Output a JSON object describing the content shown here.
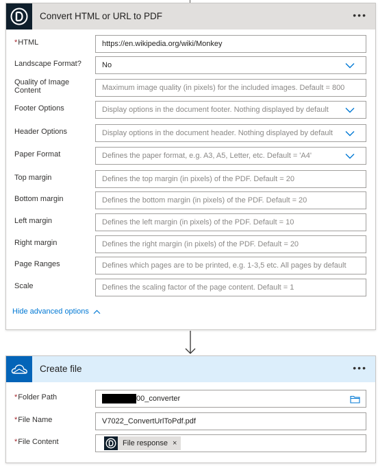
{
  "action1": {
    "title": "Convert HTML or URL to PDF",
    "more_label": "•••",
    "icon": "pdf-logo-icon",
    "fields": [
      {
        "label": "HTML",
        "required": true,
        "value": "https://en.wikipedia.org/wiki/Monkey",
        "placeholder": ""
      },
      {
        "label": "Landscape Format?",
        "required": false,
        "value": "No",
        "placeholder": "",
        "dropdown": true
      },
      {
        "label": "Quality of Image Content",
        "required": false,
        "value": "",
        "placeholder": "Maximum image quality (in pixels) for the included images. Default = 800"
      },
      {
        "label": "Footer Options",
        "required": false,
        "value": "",
        "placeholder": "Display options in the document footer. Nothing displayed by default",
        "dropdown": true
      },
      {
        "label": "Header Options",
        "required": false,
        "value": "",
        "placeholder": "Display options in the document header. Nothing displayed by default",
        "dropdown": true
      },
      {
        "label": "Paper Format",
        "required": false,
        "value": "",
        "placeholder": "Defines the paper format, e.g. A3, A5, Letter, etc. Default = 'A4'",
        "dropdown": true
      },
      {
        "label": "Top margin",
        "required": false,
        "value": "",
        "placeholder": "Defines the top margin (in pixels) of the PDF. Default = 20"
      },
      {
        "label": "Bottom margin",
        "required": false,
        "value": "",
        "placeholder": "Defines the bottom margin (in pixels) of the PDF. Default = 20"
      },
      {
        "label": "Left margin",
        "required": false,
        "value": "",
        "placeholder": "Defines the left margin (in pixels) of the PDF. Default = 10"
      },
      {
        "label": "Right margin",
        "required": false,
        "value": "",
        "placeholder": "Defines the right margin (in pixels) of the PDF. Default = 20"
      },
      {
        "label": "Page Ranges",
        "required": false,
        "value": "",
        "placeholder": "Defines which pages are to be printed, e.g. 1-3,5 etc. All pages by default"
      },
      {
        "label": "Scale",
        "required": false,
        "value": "",
        "placeholder": "Defines the scaling factor of the page content. Default = 1"
      }
    ],
    "hide_advanced_label": "Hide advanced options"
  },
  "action2": {
    "title": "Create file",
    "more_label": "•••",
    "icon": "onedrive-cloud-icon",
    "folder_path": {
      "label": "Folder Path",
      "value_suffix": "00_converter"
    },
    "file_name": {
      "label": "File Name",
      "value": "V7022_ConvertUrlToPdf.pdf"
    },
    "file_content": {
      "label": "File Content",
      "token_label": "File response",
      "token_close": "×"
    }
  },
  "colors": {
    "link": "#0078d4",
    "required_star": "#a4262c",
    "header_gray": "#e1dfdd",
    "header_blue": "#dceefb"
  }
}
